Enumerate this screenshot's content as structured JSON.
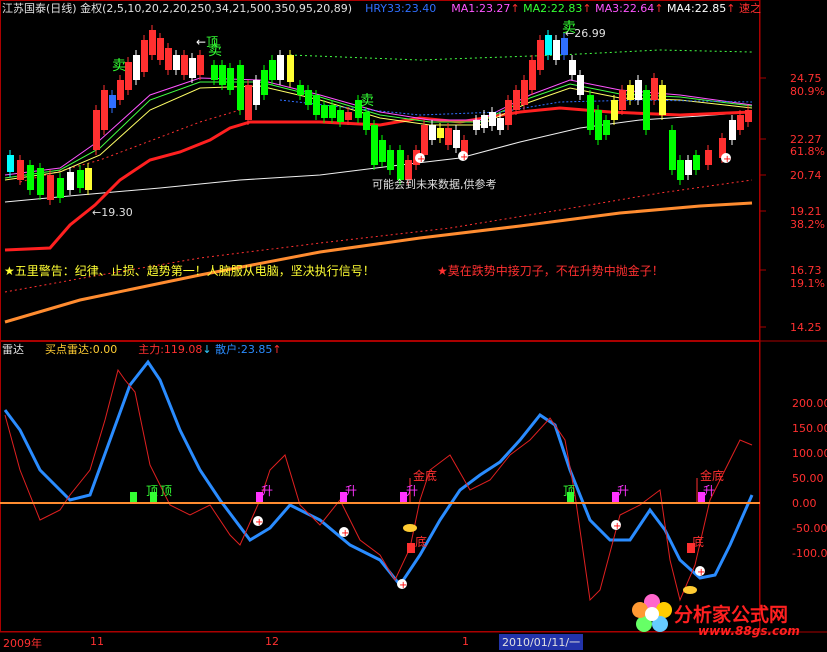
{
  "colors": {
    "background": "#000000",
    "frame": "#aa0000",
    "up_candle": "#ff3030",
    "down_candle": "#00ffff",
    "support_line": "#ff2020",
    "orange_line": "#ff8c30",
    "blue_line": "#2a8cff",
    "red_line": "#e02020",
    "green_marker": "#33ff33",
    "magenta_marker": "#ff33ff"
  },
  "top_panel": {
    "title": "江苏国泰(日线)",
    "adjust": "金权",
    "params": "(2,5,10,20,2,20,250,34,21,500,350,95,20,89)",
    "indicators": [
      {
        "label": "HRY33:23.40",
        "color": "#2f6fff",
        "arrow": ""
      },
      {
        "label": "MA1:23.27",
        "color": "#ff55ff",
        "arrow": "↑"
      },
      {
        "label": "MA2:22.83",
        "color": "#33ff33",
        "arrow": "↑"
      },
      {
        "label": "MA3:22.64",
        "color": "#ff55ff",
        "arrow": "↑"
      },
      {
        "label": "MA4:22.85",
        "color": "#ffffff",
        "arrow": "↑"
      },
      {
        "label": "速之",
        "color": "#ff3030",
        "arrow": ""
      }
    ],
    "price_axis": [
      "24.75",
      "80.9%",
      "22.27",
      "61.8%",
      "20.74",
      "19.21",
      "38.2%",
      "16.73",
      "19.1%",
      "14.25"
    ],
    "annotations": {
      "top": "顶",
      "sell1": "卖",
      "sell2": "卖",
      "sell3": "卖",
      "high_price": "26.99",
      "low_price": "19.30",
      "future_data": "可能会到未来数据,供参考"
    },
    "warning_left": "★五里警告：纪律、止损、趋势第一！人脑服从电脑，坚决执行信号！",
    "warning_right": "★莫在跌势中接刀子，不在升势中抛金子！"
  },
  "bottom_panel": {
    "name": "雷达",
    "buy_radar": "买点雷达:0.00",
    "main_force": "主力:119.08",
    "retail": "散户:23.85",
    "main_force_arrow": "↓",
    "retail_arrow": "↑",
    "y_axis": [
      "200.00",
      "150.00",
      "100.00",
      "50.00",
      "0.00",
      "-50.00",
      "-100.00"
    ],
    "markers": {
      "top1": "顶",
      "top2": "顶",
      "rise1": "升",
      "rise2": "升",
      "rise3": "升",
      "rise4": "升",
      "rise5": "升",
      "gold_bottom1": "金底",
      "gold_bottom2": "金底",
      "bottom1": "底",
      "bottom2": "底",
      "top3": "顶"
    }
  },
  "time_axis": [
    "2009年",
    "11",
    "12",
    "1",
    "2010/01/11/一"
  ],
  "watermark": {
    "cn": "分析家公式网",
    "url": "www.88gs.com"
  }
}
